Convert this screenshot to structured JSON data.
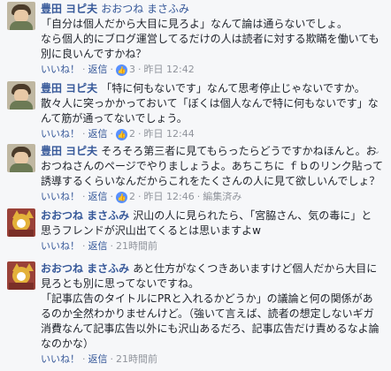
{
  "comments": [
    {
      "author": "豊田 ヨピ夫",
      "lines": [
        "おおつね まさふみ",
        "「自分は個人だから大目に見ろよ」なんて論は通らないでしょ。",
        "なら個人的にブログ運営してるだけの人は読者に対する欺瞞を働いても",
        "別に良いんですかね？"
      ],
      "like_label": "いいね！",
      "reply_label": "返信",
      "reaction_count": "3",
      "time": "昨日 12:42",
      "edited": ""
    },
    {
      "author": "豊田 ヨピ夫",
      "lines": [
        "「特に何もないです」なんて思考停止じゃないですか。",
        "散々人に突っかかっておいて「ぼくは個人なんで特に何もないです」な",
        "んて筋が通ってないでしょう。"
      ],
      "like_label": "いいね！",
      "reply_label": "返信",
      "reaction_count": "2",
      "time": "昨日 12:44",
      "edited": ""
    },
    {
      "author": "豊田 ヨピ夫",
      "lines": [
        "そろそろ第三者に見てもらったらどうですかねほんと。お",
        "おつねさんのページでやりましょうよ。あちこちに ｆｂのリンク貼って",
        "誘導するくらいなんだからこれをたくさんの人に見て欲しいんでしょ？"
      ],
      "like_label": "いいね！",
      "reply_label": "返信",
      "reaction_count": "2",
      "time": "昨日 12:46",
      "edited": "編集済み"
    },
    {
      "author": "おおつね まさふみ",
      "lines": [
        "沢山の人に見られたら、「宮脇さん、気の毒に」と",
        "思うフレンドが沢山出てくるとは思いますよw"
      ],
      "like_label": "いいね！",
      "reply_label": "返信",
      "reaction_count": "",
      "time": "21時間前",
      "edited": ""
    },
    {
      "author": "おおつね まさふみ",
      "lines": [
        "あと仕方がなくつきあいますけど個人だから大目に",
        "見ろとも別に思ってないですね。",
        "「記事広告のタイトルにPRと入れるかどうか」の議論と何の関係があ",
        "るのか全然わかりませんけど。（強いて言えば、読者の想定しないギガ",
        "消費なんて記事広告以外にも沢山あるだろ、記事広告だけ責めるなよ論",
        "なのかな）"
      ],
      "like_label": "いいね！",
      "reply_label": "返信",
      "reaction_count": "",
      "time": "21時間前",
      "edited": ""
    }
  ],
  "icons": {
    "like_reaction": "thumbs-up-icon",
    "options": "chevron-down-icon"
  },
  "colors": {
    "author": "#365899",
    "meta": "#90949c",
    "like_badge": "#5890ff",
    "background": "#f6f7f9"
  }
}
